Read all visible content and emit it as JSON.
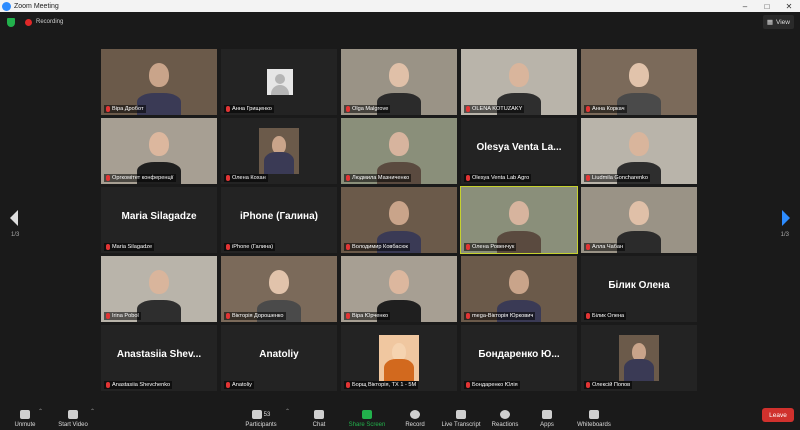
{
  "window": {
    "title": "Zoom Meeting"
  },
  "topbar": {
    "recording": "Recording",
    "view": "View"
  },
  "pagination": {
    "left": "1/3",
    "right": "1/3"
  },
  "tiles": [
    {
      "name": "Віра Дробот",
      "big": "",
      "type": "video"
    },
    {
      "name": "Анна Грищенко",
      "big": "",
      "type": "avatar"
    },
    {
      "name": "Olga Malgrove",
      "big": "",
      "type": "video"
    },
    {
      "name": "OLENA KOTUZAKY",
      "big": "",
      "type": "video"
    },
    {
      "name": "Анна Коркач",
      "big": "",
      "type": "video"
    },
    {
      "name": "Оргкомітет конференції",
      "big": "",
      "type": "video"
    },
    {
      "name": "Олена Кохан",
      "big": "",
      "type": "photo"
    },
    {
      "name": "Людмила Мазниченко",
      "big": "",
      "type": "video"
    },
    {
      "name": "Olesya Venta Lab Agro",
      "big": "Olesya Venta La...",
      "type": "name"
    },
    {
      "name": "Liudmila Goncharenko",
      "big": "",
      "type": "video"
    },
    {
      "name": "Maria Silagadze",
      "big": "Maria Silagadze",
      "type": "name"
    },
    {
      "name": "iPhone (Галина)",
      "big": "iPhone (Галина)",
      "type": "name"
    },
    {
      "name": "Володимир Ковбасюк",
      "big": "",
      "type": "video"
    },
    {
      "name": "Олена Ровенчук",
      "big": "",
      "type": "video",
      "active": true
    },
    {
      "name": "Алла Чабан",
      "big": "",
      "type": "video"
    },
    {
      "name": "Irina Pobol",
      "big": "",
      "type": "video"
    },
    {
      "name": "Вікторія Дорошенко",
      "big": "",
      "type": "video"
    },
    {
      "name": "Віра Юрченко",
      "big": "",
      "type": "video"
    },
    {
      "name": "mega-Вікторія Юркович",
      "big": "",
      "type": "video"
    },
    {
      "name": "Білик Олена",
      "big": "Білик Олена",
      "type": "name"
    },
    {
      "name": "Anastasiia Shevchenko",
      "big": "Anastasiia Shev...",
      "type": "name"
    },
    {
      "name": "Anatoliy",
      "big": "Anatoliy",
      "type": "name"
    },
    {
      "name": "Борщ Вікторія, ТХ 1 - 5М",
      "big": "",
      "type": "cartoon"
    },
    {
      "name": "Бондаренко Юлія",
      "big": "Бондаренко Ю...",
      "type": "name"
    },
    {
      "name": "Олексій Попов",
      "big": "",
      "type": "photo"
    }
  ],
  "toolbar": {
    "unmute": "Unmute",
    "start_video": "Start Video",
    "participants": "Participants",
    "participants_count": "53",
    "chat": "Chat",
    "share_screen": "Share Screen",
    "record": "Record",
    "live_transcript": "Live Transcript",
    "reactions": "Reactions",
    "apps": "Apps",
    "whiteboards": "Whiteboards",
    "leave": "Leave"
  }
}
